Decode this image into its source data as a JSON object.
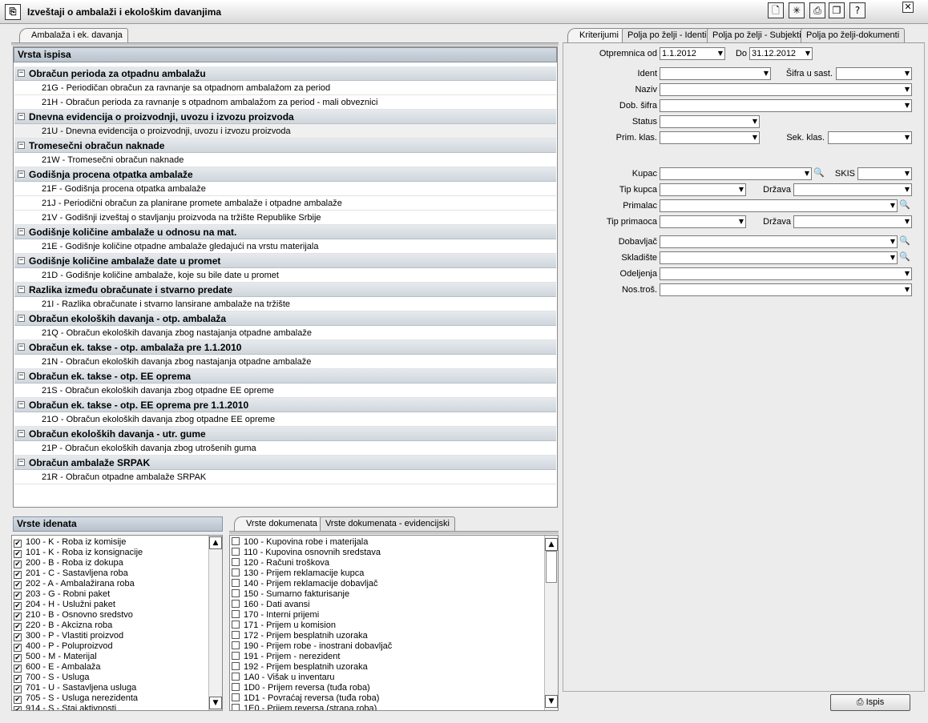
{
  "window": {
    "title": "Izveštaji o ambalaži i ekološkim davanjima",
    "app_icon": "report-app-icon",
    "toolbar_icons": [
      "document-icon",
      "wand-icon",
      "print-icon",
      "copy-window-icon",
      "help-icon"
    ],
    "toolbar_glyphs": [
      "🗋",
      "✳",
      "⎙",
      "❐",
      "?"
    ],
    "close_glyph": "✕"
  },
  "left_tab": {
    "label": "Ambalaža i ek. davanja"
  },
  "report_list": {
    "header": "Vrsta ispisa",
    "rows": [
      {
        "type": "group",
        "label": "Obračun perioda za otpadnu ambalažu"
      },
      {
        "type": "item",
        "label": "21G - Periodičan obračun za ravnanje sa otpadnom ambalažom za period"
      },
      {
        "type": "item",
        "label": "21H - Obračun perioda za ravnanje s otpadnom ambalažom za period - mali obveznici"
      },
      {
        "type": "group",
        "label": "Dnevna evidencija o proizvodnji, uvozu i izvozu proizvoda"
      },
      {
        "type": "item",
        "label": "21U - Dnevna evidencija o proizvodnji, uvozu i izvozu proizvoda",
        "selected": true
      },
      {
        "type": "group",
        "label": "Tromesečni obračun naknade"
      },
      {
        "type": "item",
        "label": "21W - Tromesečni obračun naknade"
      },
      {
        "type": "group",
        "label": "Godišnja procena otpatka ambalaže"
      },
      {
        "type": "item",
        "label": "21F - Godišnja procena otpatka ambalaže"
      },
      {
        "type": "item",
        "label": "21J - Periodični obračun za planirane promete ambalaže i otpadne ambalaže"
      },
      {
        "type": "item",
        "label": "21V - Godišnji izveštaj o stavljanju proizvoda na tržište Republike Srbije"
      },
      {
        "type": "group",
        "label": "Godišnje količine ambalaže u odnosu na mat."
      },
      {
        "type": "item",
        "label": "21E - Godišnje količine otpadne ambalaže gledajući na vrstu materijala"
      },
      {
        "type": "group",
        "label": "Godišnje količine ambalaže date u promet"
      },
      {
        "type": "item",
        "label": "21D - Godišnje količine ambalaže, koje su bile date u promet"
      },
      {
        "type": "group",
        "label": "Razlika između obračunate i stvarno predate"
      },
      {
        "type": "item",
        "label": "21I - Razlika obračunate i stvarno lansirane ambalaže na tržište"
      },
      {
        "type": "group",
        "label": "Obračun ekoloških davanja - otp. ambalaža"
      },
      {
        "type": "item",
        "label": "21Q - Obračun ekoloških davanja zbog nastajanja otpadne ambalaže"
      },
      {
        "type": "group",
        "label": "Obračun ek. takse - otp. ambalaža  pre 1.1.2010"
      },
      {
        "type": "item",
        "label": "21N - Obračun ekoloških davanja zbog nastajanja otpadne ambalaže"
      },
      {
        "type": "group",
        "label": "Obračun ek. takse - otp. EE oprema"
      },
      {
        "type": "item",
        "label": "21S - Obračun ekoloških davanja zbog otpadne EE opreme"
      },
      {
        "type": "group",
        "label": "Obračun ek. takse - otp. EE oprema pre 1.1.2010"
      },
      {
        "type": "item",
        "label": "21O - Obračun ekoloških davanja zbog otpadne EE opreme"
      },
      {
        "type": "group",
        "label": "Obračun ekoloških davanja - utr. gume"
      },
      {
        "type": "item",
        "label": "21P - Obračun ekoloških davanja zbog utrošenih guma"
      },
      {
        "type": "group",
        "label": "Obračun ambalaže SRPAK"
      },
      {
        "type": "item",
        "label": "21R - Obračun otpadne ambalaže SRPAK"
      }
    ]
  },
  "ident_types": {
    "header": "Vrste idenata",
    "items": [
      {
        "label": "100 - K - Roba iz komisije",
        "checked": true
      },
      {
        "label": "101 - K - Roba iz konsignacije",
        "checked": true
      },
      {
        "label": "200 - B - Roba iz dokupa",
        "checked": true
      },
      {
        "label": "201 - C - Sastavljena roba",
        "checked": true
      },
      {
        "label": "202 - A - Ambalažirana roba",
        "checked": true
      },
      {
        "label": "203 - G - Robni paket",
        "checked": true
      },
      {
        "label": "204 - H - Uslužni paket",
        "checked": true
      },
      {
        "label": "210 - B - Osnovno sredstvo",
        "checked": true
      },
      {
        "label": "220 - B - Akcizna roba",
        "checked": true
      },
      {
        "label": "300 - P - Vlastiti proizvod",
        "checked": true
      },
      {
        "label": "400 - P - Poluproizvod",
        "checked": true
      },
      {
        "label": "500 - M - Materijal",
        "checked": true
      },
      {
        "label": "600 - E - Ambalaža",
        "checked": true
      },
      {
        "label": "700 - S - Usluga",
        "checked": true
      },
      {
        "label": "701 - U - Sastavljena usluga",
        "checked": true
      },
      {
        "label": "705 - S - Usluga nerezidenta",
        "checked": true
      },
      {
        "label": "914 - S - Stai aktivnosti",
        "checked": true
      }
    ]
  },
  "doc_tabs": [
    "Vrste dokumenata",
    "Vrste dokumenata - evidencijski"
  ],
  "doc_types": {
    "items": [
      {
        "label": "100 - Kupovina robe i materijala",
        "checked": false
      },
      {
        "label": "110 - Kupovina osnovnih sredstava",
        "checked": false
      },
      {
        "label": "120 - Računi troškova",
        "checked": false
      },
      {
        "label": "130 - Prijem reklamacije kupca",
        "checked": false
      },
      {
        "label": "140 - Prijem reklamacije dobavljač",
        "checked": false
      },
      {
        "label": "150 - Sumarno fakturisanje",
        "checked": false
      },
      {
        "label": "160 - Dati avansi",
        "checked": false
      },
      {
        "label": "170 - Interni prijemi",
        "checked": false
      },
      {
        "label": "171 - Prijem u komision",
        "checked": false
      },
      {
        "label": "172 - Prijem besplatnih uzoraka",
        "checked": false
      },
      {
        "label": "190 - Prijem robe - inostrani dobavljač",
        "checked": false
      },
      {
        "label": "191 - Prijem - nerezident",
        "checked": false
      },
      {
        "label": "192 - Prijem besplatnih uzoraka",
        "checked": false
      },
      {
        "label": "1A0 - Višak u inventaru",
        "checked": false
      },
      {
        "label": "1D0 - Prijem reversa  (tuđa roba)",
        "checked": false
      },
      {
        "label": "1D1 - Povraćaj reversa  (tuđa roba)",
        "checked": false
      },
      {
        "label": "1E0 - Prijem reversa (strana roba)",
        "checked": false
      }
    ]
  },
  "right_tabs": [
    "Kriterijumi",
    "Polja po želji - Identi",
    "Polja po želji - Subjekti",
    "Polja po želji-dokumenti"
  ],
  "criteria": {
    "otpremnica_od_label": "Otpremnica od",
    "otpremnica_od_value": "1.1.2012",
    "do_label": "Do",
    "do_value": "31.12.2012",
    "ident_label": "Ident",
    "sifra_label": "Šifra u sast.",
    "naziv_label": "Naziv",
    "dob_sifra_label": "Dob. šifra",
    "status_label": "Status",
    "prim_klas_label": "Prim. klas.",
    "sek_klas_label": "Sek. klas.",
    "kupac_label": "Kupac",
    "skis_label": "SKIS",
    "tip_kupca_label": "Tip kupca",
    "drzava1_label": "Država",
    "primalac_label": "Primalac",
    "tip_primaoca_label": "Tip primaoca",
    "drzava2_label": "Država",
    "dobavljac_label": "Dobavljač",
    "skladiste_label": "Skladište",
    "odeljenja_label": "Odeljenja",
    "nos_tros_label": "Nos.troš."
  },
  "glyphs": {
    "arrow": "▼",
    "lens": "🔍",
    "check": "✔",
    "minus": "−",
    "up": "▲",
    "down": "▼",
    "printer": "⎙"
  },
  "ispis_button": {
    "label": "Ispis"
  }
}
